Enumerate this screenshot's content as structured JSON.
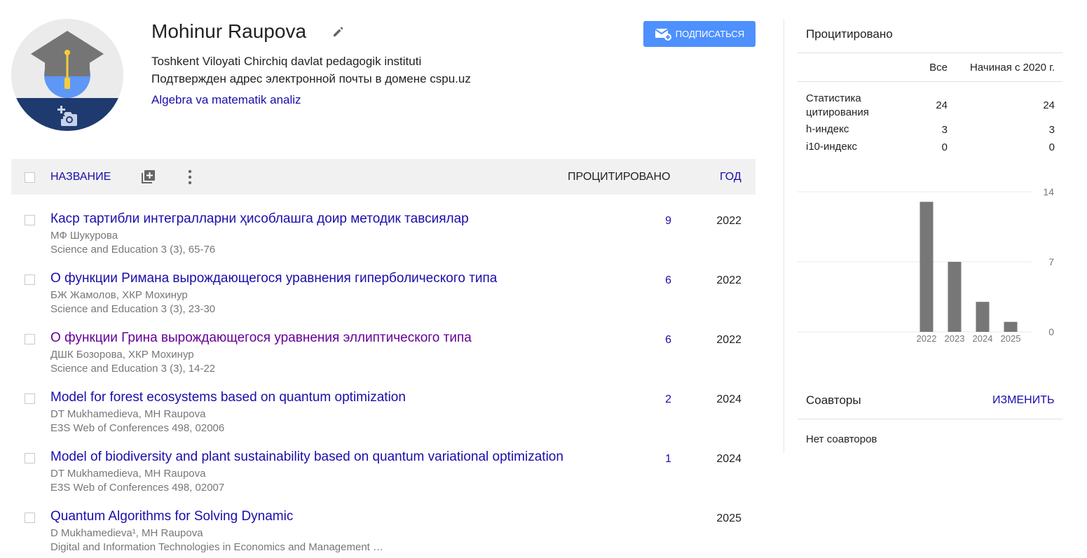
{
  "profile": {
    "name": "Mohinur Raupova",
    "affiliation": "Toshkent Viloyati Chirchiq davlat pedagogik instituti",
    "email_verified": "Подтвержден адрес электронной почты в домене cspu.uz",
    "interest": "Algebra va matematik analiz",
    "follow_label": "ПОДПИСАТЬСЯ"
  },
  "table": {
    "col_title": "НАЗВАНИЕ",
    "col_cited": "ПРОЦИТИРОВАНО",
    "col_year": "ГОД",
    "rows": [
      {
        "title": "Каср тартибли интегралларни ҳисоблашга доир методик тавсиялар",
        "authors": "МФ Шукурова",
        "venue": "Science and Education 3 (3), 65-76",
        "cited": "9",
        "year": "2022",
        "visited": false
      },
      {
        "title": "О функции Римана вырождающегося уравнения гиперболического типа",
        "authors": "БЖ Жамолов, ХКР Мохинур",
        "venue": "Science and Education 3 (3), 23-30",
        "cited": "6",
        "year": "2022",
        "visited": false
      },
      {
        "title": "О функции Грина вырождающегося уравнения эллиптического типа",
        "authors": "ДШК Бозорова, ХКР Мохинур",
        "venue": "Science and Education 3 (3), 14-22",
        "cited": "6",
        "year": "2022",
        "visited": true
      },
      {
        "title": "Model for forest ecosystems based on quantum optimization",
        "authors": "DT Mukhamedieva, MH Raupova",
        "venue": "E3S Web of Conferences 498, 02006",
        "cited": "2",
        "year": "2024",
        "visited": false
      },
      {
        "title": "Model of biodiversity and plant sustainability based on quantum variational optimization",
        "authors": "DT Mukhamedieva, MH Raupova",
        "venue": "E3S Web of Conferences 498, 02007",
        "cited": "1",
        "year": "2024",
        "visited": false
      },
      {
        "title": "Quantum Algorithms for Solving Dynamic",
        "authors": "D Mukhamedieva¹, MH Raupova",
        "venue": "Digital and Information Technologies in Economics and Management …",
        "cited": "",
        "year": "2025",
        "visited": false
      }
    ]
  },
  "citations": {
    "title": "Процитировано",
    "col_all": "Все",
    "col_since": "Начиная с 2020 г.",
    "stats": [
      {
        "label": "Статистика цитирования",
        "all": "24",
        "since": "24"
      },
      {
        "label": "h-индекс",
        "all": "3",
        "since": "3"
      },
      {
        "label": "i10-индекс",
        "all": "0",
        "since": "0"
      }
    ]
  },
  "chart_data": {
    "type": "bar",
    "categories": [
      "2022",
      "2023",
      "2024",
      "2025"
    ],
    "values": [
      13,
      7,
      3,
      1
    ],
    "ylim": [
      0,
      14
    ],
    "yticks": [
      "14",
      "7",
      "0"
    ],
    "bar_color": "#777777",
    "grid": true
  },
  "coauthors": {
    "title": "Соавторы",
    "edit_label": "ИЗМЕНИТЬ",
    "empty_text": "Нет соавторов"
  },
  "colors": {
    "link": "#1a0dab",
    "visited": "#660099",
    "button": "#4d90fe"
  }
}
